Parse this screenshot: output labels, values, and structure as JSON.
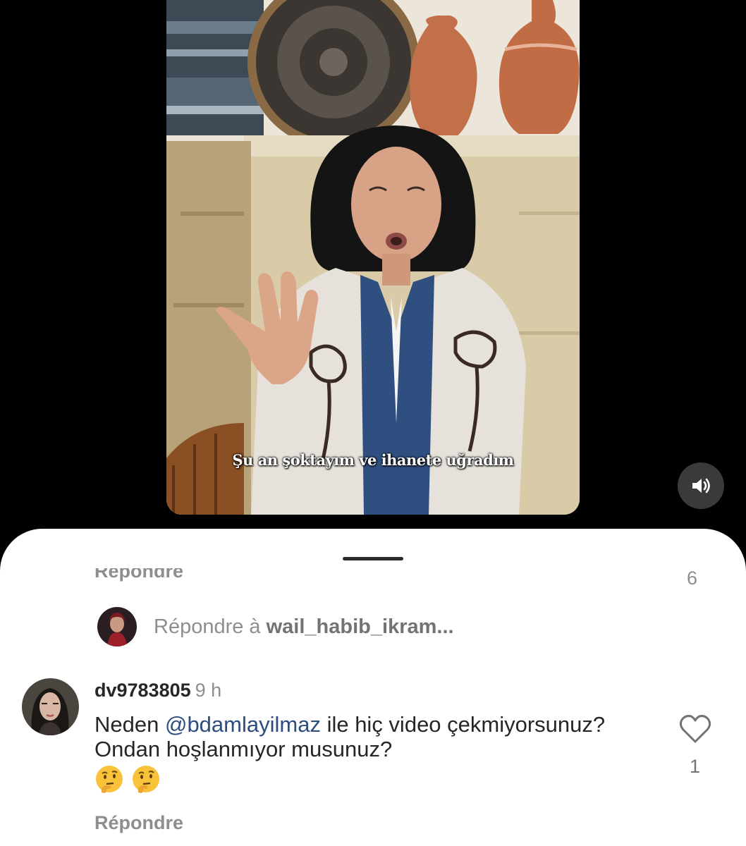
{
  "video": {
    "subtitle": "Şu an şoktayım ve ihanete uğradım",
    "sound_icon": "speaker-on-icon"
  },
  "sheet": {
    "cut_reply_label": "Répondre",
    "cut_count": "6",
    "reply_to_label": "Répondre à",
    "reply_to_user": "wail_habib_ikram...",
    "comment": {
      "username": "dv9783805",
      "time": "9 h",
      "text_before": "Neden ",
      "mention": "@bdamlayilmaz",
      "text_after": " ile hiç video çekmiyorsunuz? Ondan hoşlanmıyor musunuz?",
      "emojis": [
        "thinking-face-icon",
        "thinking-face-icon"
      ],
      "reply_label": "Répondre",
      "like_icon": "heart-outline-icon",
      "like_count": "1"
    }
  }
}
